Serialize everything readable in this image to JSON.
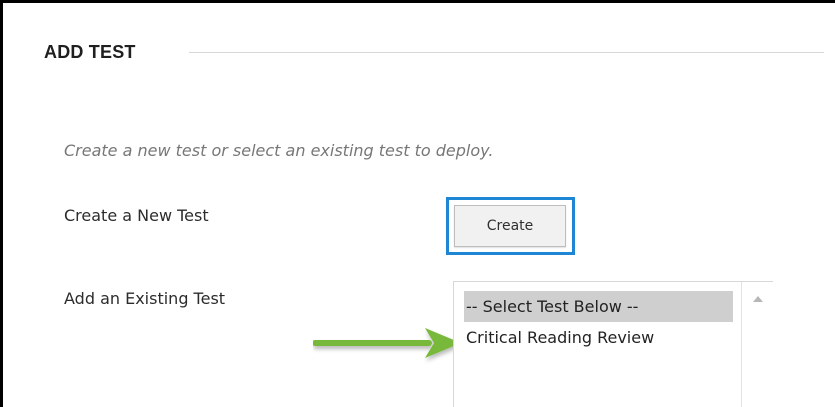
{
  "section": {
    "title": "ADD TEST"
  },
  "instructions": "Create a new test or select an existing test to deploy.",
  "fields": {
    "create_label": "Create a New Test",
    "existing_label": "Add an Existing Test"
  },
  "buttons": {
    "create": "Create"
  },
  "test_list": {
    "selected": "-- Select Test Below --",
    "options": [
      "-- Select Test Below --",
      "Critical Reading Review"
    ]
  },
  "annotation": {
    "color": "#78b83b",
    "icon": "green-arrow-icon"
  },
  "colors": {
    "focus": "#1f86d6",
    "selection": "#cfcfcf",
    "instruction_text": "#777777"
  }
}
